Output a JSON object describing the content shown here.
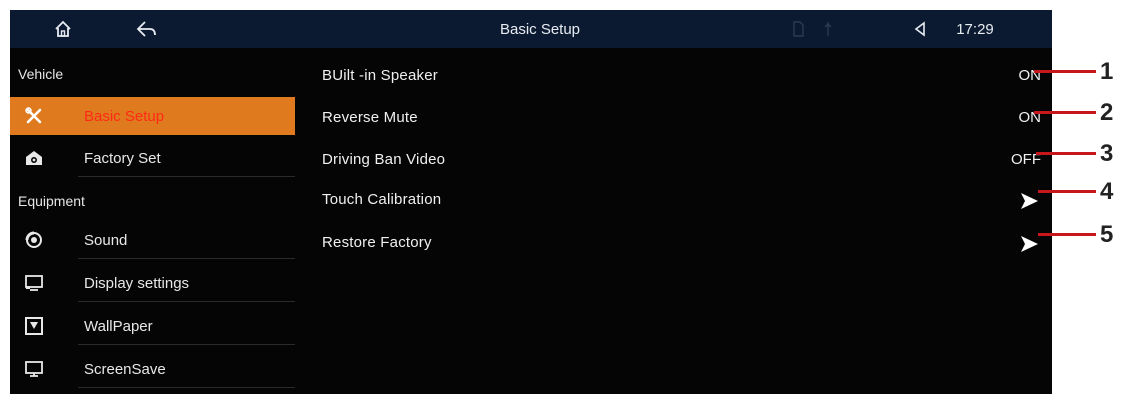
{
  "topbar": {
    "title": "Basic Setup",
    "time": "17:29",
    "home_icon": "home-icon",
    "back_icon": "back-icon",
    "volume_icon": "volume-icon"
  },
  "sidebar": {
    "sections": [
      "Vehicle",
      "Equipment"
    ],
    "items": [
      {
        "label": "Basic Setup",
        "icon": "tools-icon",
        "active": true
      },
      {
        "label": "Factory Set",
        "icon": "factory-icon",
        "active": false
      },
      {
        "label": "Sound",
        "icon": "sound-icon",
        "active": false
      },
      {
        "label": "Display settings",
        "icon": "display-icon",
        "active": false
      },
      {
        "label": "WallPaper",
        "icon": "wallpaper-icon",
        "active": false
      },
      {
        "label": "ScreenSave",
        "icon": "monitor-icon",
        "active": false
      }
    ]
  },
  "settings": [
    {
      "label": "BUilt  -in   Speaker",
      "value": "ON"
    },
    {
      "label": "Reverse Mute",
      "value": "ON"
    },
    {
      "label": "Driving Ban Video",
      "value": "OFF"
    },
    {
      "label": "Touch Calibration",
      "value": ""
    },
    {
      "label": "Restore Factory",
      "value": ""
    }
  ],
  "callouts": [
    "1",
    "2",
    "3",
    "4",
    "5"
  ],
  "colors": {
    "active_bg": "#e07a1f",
    "active_text": "#ff2a14",
    "topbar_bg": "#0b1a30",
    "callout_line": "#c8161d"
  }
}
